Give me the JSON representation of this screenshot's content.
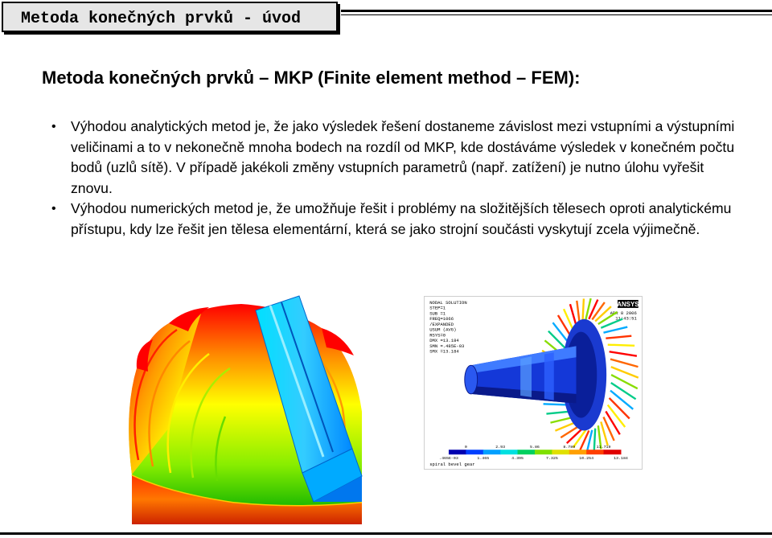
{
  "slide": {
    "header_title": "Metoda konečných prvků - úvod",
    "heading": "Metoda konečných prvků – MKP (Finite element method – FEM):",
    "bullets": [
      {
        "text": "Výhodou analytických metod je, že jako výsledek řešení dostaneme závislost mezi vstupními a výstupními veličinami a to v nekonečně mnoha bodech na rozdíl od MKP, kde dostáváme výsledek v konečném počtu bodů (uzlů sítě). V případě jakékoli změny vstupních parametrů (např. zatížení) je nutno úlohu vyřešit znovu."
      },
      {
        "text": "Výhodou numerických metod je, že umožňuje řešit i problémy na složitějších tělesech oproti analytickému přístupu, kdy lze řešit jen tělesa elementární, která se jako strojní součásti vyskytují zcela výjimečně."
      }
    ]
  },
  "ansys_figure": {
    "logo": "ANSYS",
    "info_lines": [
      "NODAL SOLUTION",
      "STEP=1",
      "SUB =1",
      "FREQ=1066",
      "/EXPANDED",
      "USUM (AVG)",
      "RSYS=0",
      "DMX =13.184",
      "SMN =.485E-03",
      "SMX =13.184"
    ],
    "date": "APR 8 2006",
    "time": "11:43:51",
    "legend_top": [
      "0",
      "2.93",
      "5.86",
      "8.789",
      "11.719"
    ],
    "legend_bottom": [
      ".465E-03",
      "1.465",
      "4.395",
      "7.325",
      "10.254",
      "13.184"
    ],
    "caption": "spiral bevel gear",
    "legend_colors": [
      "#0000b0",
      "#0040ff",
      "#00a0ff",
      "#00e0e0",
      "#00d060",
      "#80e000",
      "#e0e000",
      "#ffa000",
      "#ff4000",
      "#e00000"
    ]
  }
}
